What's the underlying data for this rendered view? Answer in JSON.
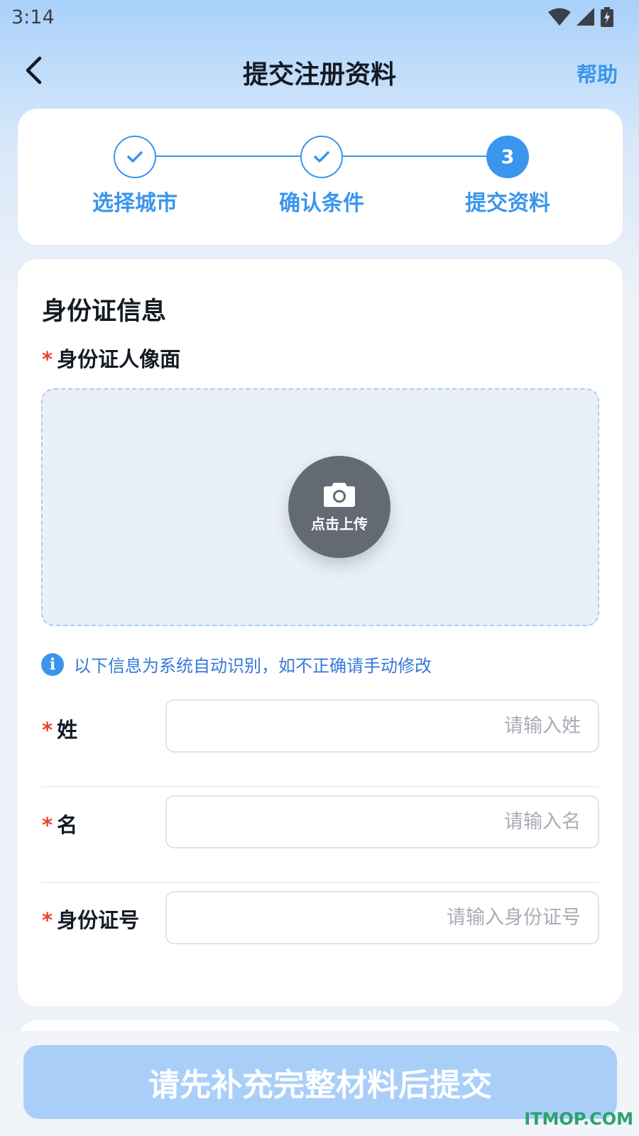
{
  "status_bar": {
    "time": "3:14"
  },
  "nav": {
    "title": "提交注册资料",
    "help_label": "帮助"
  },
  "steps": [
    {
      "label": "选择城市",
      "state": "done"
    },
    {
      "label": "确认条件",
      "state": "done"
    },
    {
      "label": "提交资料",
      "state": "active",
      "number": "3"
    }
  ],
  "form": {
    "section_title": "身份证信息",
    "required_mark": "*",
    "id_front_label": "身份证人像面",
    "upload_label": "点击上传",
    "notice_icon": "i",
    "notice_text": "以下信息为系统自动识别，如不正确请手动修改",
    "fields": [
      {
        "label": "姓",
        "value": "",
        "placeholder": "请输入姓"
      },
      {
        "label": "名",
        "value": "",
        "placeholder": "请输入名"
      },
      {
        "label": "身份证号",
        "value": "",
        "placeholder": "请输入身份证号"
      }
    ]
  },
  "submit": {
    "label": "请先补充完整材料后提交"
  },
  "watermark": "ITMOP.COM",
  "colors": {
    "accent": "#3a96ec",
    "required": "#e8432f",
    "submit_disabled": "#a9cff9"
  }
}
